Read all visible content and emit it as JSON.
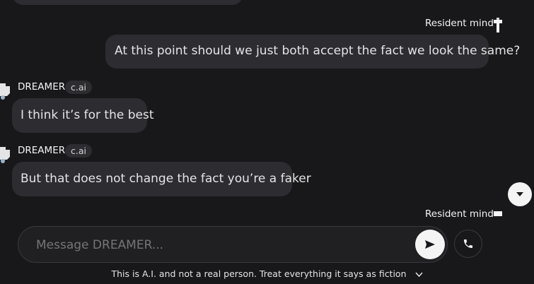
{
  "messages": [
    {
      "author": "Resident mind",
      "text": "At this point should we just both accept the fact we look the same?"
    },
    {
      "author": "DREAMER",
      "badge": "c.ai",
      "text": "I think it’s for the best"
    },
    {
      "author": "DREAMER",
      "badge": "c.ai",
      "text": "But that does not change the fact you’re a faker"
    }
  ],
  "cutoff_author": "Resident mind",
  "composer": {
    "placeholder": "Message DREAMER..."
  },
  "disclaimer": "This is A.I. and not a real person. Treat everything it says as fiction",
  "icons": {
    "send": "send-icon",
    "call": "phone-icon",
    "scroll": "chevron-down-icon",
    "disclaimer": "chevron-down-icon",
    "avatar": "avatar-icon"
  },
  "colors": {
    "background": "#18181b",
    "bubble": "#2d2d31",
    "accent": "#f4f4f5"
  }
}
